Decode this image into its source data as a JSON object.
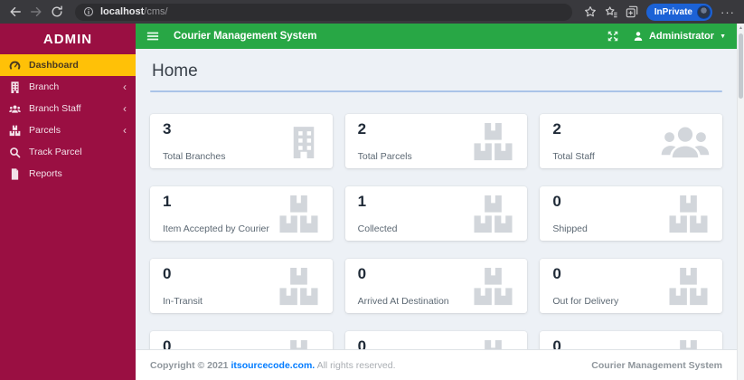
{
  "browser": {
    "url_host": "localhost",
    "url_path": "/cms/",
    "inprivate_label": "InPrivate",
    "icons": [
      "back-icon",
      "forward-icon",
      "refresh-icon",
      "info-icon",
      "favorites-icon",
      "collections-icon",
      "tab-groups-icon",
      "profile-avatar",
      "more-icon"
    ]
  },
  "sidebar": {
    "title": "ADMIN",
    "items": [
      {
        "label": "Dashboard",
        "icon": "gauge-icon",
        "active": true,
        "has_submenu": false
      },
      {
        "label": "Branch",
        "icon": "building-icon",
        "active": false,
        "has_submenu": true
      },
      {
        "label": "Branch Staff",
        "icon": "users-icon",
        "active": false,
        "has_submenu": true
      },
      {
        "label": "Parcels",
        "icon": "boxes-icon",
        "active": false,
        "has_submenu": true
      },
      {
        "label": "Track Parcel",
        "icon": "search-icon",
        "active": false,
        "has_submenu": false
      },
      {
        "label": "Reports",
        "icon": "file-icon",
        "active": false,
        "has_submenu": false
      }
    ]
  },
  "topbar": {
    "title": "Courier Management System",
    "user_label": "Administrator",
    "icons": [
      "menu-bars-icon",
      "fullscreen-expand-icon",
      "user-icon",
      "caret-down-icon"
    ]
  },
  "page": {
    "title": "Home"
  },
  "cards": [
    {
      "value": "3",
      "label": "Total Branches",
      "icon": "building-icon"
    },
    {
      "value": "2",
      "label": "Total Parcels",
      "icon": "boxes-icon"
    },
    {
      "value": "2",
      "label": "Total Staff",
      "icon": "users-icon"
    },
    {
      "value": "1",
      "label": "Item Accepted by Courier",
      "icon": "boxes-icon"
    },
    {
      "value": "1",
      "label": "Collected",
      "icon": "boxes-icon"
    },
    {
      "value": "0",
      "label": "Shipped",
      "icon": "boxes-icon"
    },
    {
      "value": "0",
      "label": "In-Transit",
      "icon": "boxes-icon"
    },
    {
      "value": "0",
      "label": "Arrived At Destination",
      "icon": "boxes-icon"
    },
    {
      "value": "0",
      "label": "Out for Delivery",
      "icon": "boxes-icon"
    },
    {
      "value": "0",
      "label": "",
      "icon": "boxes-icon"
    },
    {
      "value": "0",
      "label": "",
      "icon": "boxes-icon"
    },
    {
      "value": "0",
      "label": "",
      "icon": "boxes-icon"
    }
  ],
  "footer": {
    "copyright": "Copyright © 2021",
    "link_text": "itsourcecode.com.",
    "rights": "All rights reserved.",
    "brand": "Courier Management System"
  },
  "colors": {
    "sidebar_bg": "#9a0f42",
    "active_item_bg": "#ffc107",
    "topbar_bg": "#28a745",
    "content_bg": "#edf1f6",
    "link_blue": "#007bff",
    "card_icon_gray": "#d2d6db"
  }
}
